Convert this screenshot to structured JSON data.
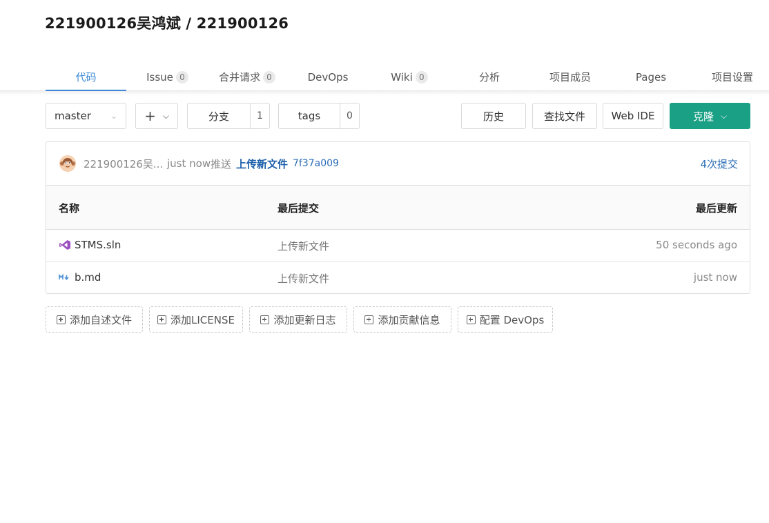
{
  "repo": {
    "title": "221900126吴鸿斌 / 221900126"
  },
  "tabs": [
    {
      "label": "代码",
      "count": null,
      "active": true
    },
    {
      "label": "Issue",
      "count": "0"
    },
    {
      "label": "合并请求",
      "count": "0"
    },
    {
      "label": "DevOps",
      "count": null
    },
    {
      "label": "Wiki",
      "count": "0"
    },
    {
      "label": "分析",
      "count": null
    },
    {
      "label": "项目成员",
      "count": null
    },
    {
      "label": "Pages",
      "count": null
    },
    {
      "label": "项目设置",
      "count": null
    }
  ],
  "toolbar": {
    "branch": "master",
    "branches_label": "分支",
    "branches_count": "1",
    "tags_label": "tags",
    "tags_count": "0",
    "history_label": "历史",
    "find_file_label": "查找文件",
    "web_ide_label": "Web IDE",
    "clone_label": "克隆",
    "accent": "#1aa084"
  },
  "last_commit": {
    "author": "221900126吴...",
    "when": "just now",
    "action": "推送",
    "message": "上传新文件",
    "sha": "7f37a009",
    "commits_label": "4次提交"
  },
  "table": {
    "headers": {
      "name": "名称",
      "last_commit": "最后提交",
      "last_update": "最后更新"
    },
    "rows": [
      {
        "icon": "visual-studio-icon",
        "name": "STMS.sln",
        "message": "上传新文件",
        "time": "50 seconds ago"
      },
      {
        "icon": "markdown-icon",
        "name": "b.md",
        "message": "上传新文件",
        "time": "just now"
      }
    ]
  },
  "add_actions": [
    {
      "label": "添加自述文件"
    },
    {
      "label": "添加LICENSE"
    },
    {
      "label": "添加更新日志"
    },
    {
      "label": "添加贡献信息"
    },
    {
      "label": "配置 DevOps"
    }
  ]
}
